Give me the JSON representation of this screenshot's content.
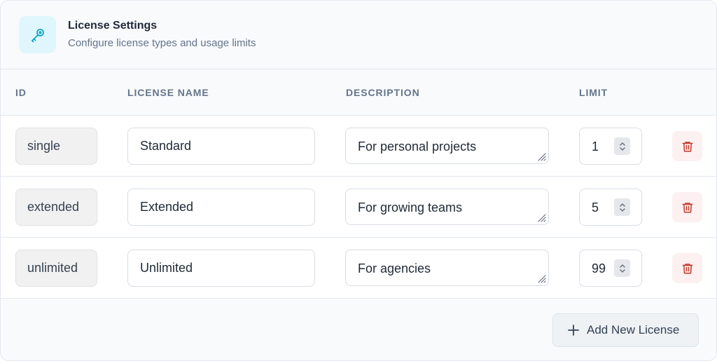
{
  "header": {
    "icon": "key-icon",
    "title": "License Settings",
    "subtitle": "Configure license types and usage limits"
  },
  "columns": {
    "id": "ID",
    "name": "LICENSE NAME",
    "description": "DESCRIPTION",
    "limit": "LIMIT"
  },
  "rows": [
    {
      "id": "single",
      "name": "Standard",
      "description": "For personal projects",
      "limit": "1"
    },
    {
      "id": "extended",
      "name": "Extended",
      "description": "For growing teams",
      "limit": "5"
    },
    {
      "id": "unlimited",
      "name": "Unlimited",
      "description": "For agencies",
      "limit": "99"
    }
  ],
  "footer": {
    "add_label": "Add New License"
  },
  "colors": {
    "accent": "#0ea5c6",
    "danger": "#c0392b",
    "header_bg": "#f8fafc"
  },
  "icons": {
    "stepper": "stepper-icon",
    "delete": "trash-icon",
    "resize": "resize-grip-icon",
    "add": "plus-icon"
  }
}
